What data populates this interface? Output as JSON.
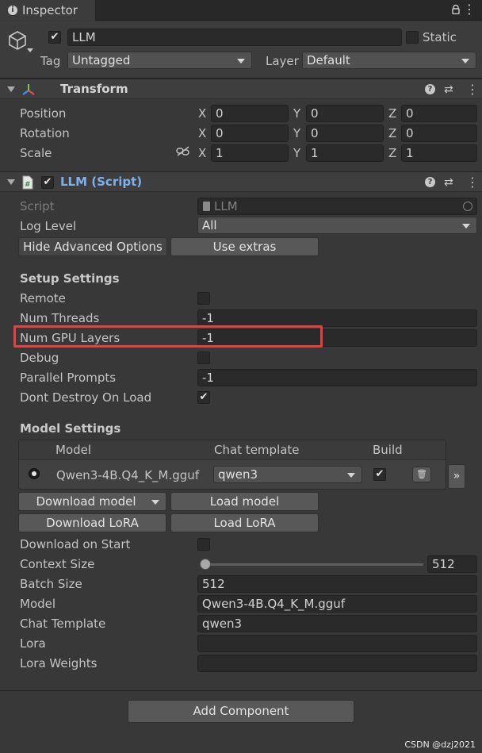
{
  "tab": {
    "title": "Inspector"
  },
  "header": {
    "object_name": "LLM",
    "static_label": "Static",
    "tag_label": "Tag",
    "tag_value": "Untagged",
    "layer_label": "Layer",
    "layer_value": "Default"
  },
  "transform": {
    "title": "Transform",
    "rows": [
      {
        "label": "Position",
        "x": "0",
        "y": "0",
        "z": "0"
      },
      {
        "label": "Rotation",
        "x": "0",
        "y": "0",
        "z": "0"
      },
      {
        "label": "Scale",
        "x": "1",
        "y": "1",
        "z": "1"
      }
    ],
    "axes": {
      "x": "X",
      "y": "Y",
      "z": "Z"
    }
  },
  "llm_script": {
    "title": "LLM (Script)",
    "script_label": "Script",
    "script_value": "LLM",
    "log_level_label": "Log Level",
    "log_level_value": "All",
    "hide_advanced_button": "Hide Advanced Options",
    "use_extras_button": "Use extras",
    "setup_title": "Setup Settings",
    "setup": {
      "remote": "Remote",
      "num_threads": "Num Threads",
      "num_threads_value": "-1",
      "num_gpu_layers": "Num GPU Layers",
      "num_gpu_layers_value": "-1",
      "debug": "Debug",
      "parallel_prompts": "Parallel Prompts",
      "parallel_prompts_value": "-1",
      "dont_destroy": "Dont Destroy On Load"
    },
    "model_title": "Model Settings",
    "model_table": {
      "col_model": "Model",
      "col_template": "Chat template",
      "col_build": "Build",
      "row_model": "Qwen3-4B.Q4_K_M.gguf",
      "row_template": "qwen3",
      "more_label": "»"
    },
    "download_model_button": "Download model",
    "load_model_button": "Load model",
    "download_lora_button": "Download LoRA",
    "load_lora_button": "Load LoRA",
    "fields": {
      "download_on_start": "Download on Start",
      "context_size": "Context Size",
      "context_size_value": "512",
      "batch_size": "Batch Size",
      "batch_size_value": "512",
      "model": "Model",
      "model_value": "Qwen3-4B.Q4_K_M.gguf",
      "chat_template": "Chat Template",
      "chat_template_value": "qwen3",
      "lora": "Lora",
      "lora_weights": "Lora Weights"
    }
  },
  "add_component_button": "Add Component",
  "watermark": "CSDN @dzj2021"
}
